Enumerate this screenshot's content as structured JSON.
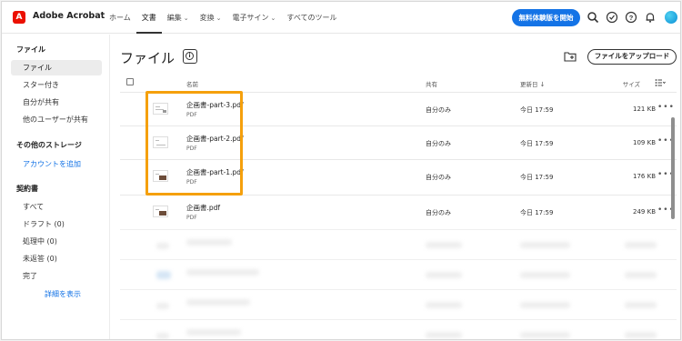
{
  "topbar": {
    "app_name": "Adobe Acrobat",
    "nav": [
      {
        "label": "ホーム",
        "dropdown": false,
        "active": false
      },
      {
        "label": "文書",
        "dropdown": false,
        "active": true
      },
      {
        "label": "編集",
        "dropdown": true,
        "active": false
      },
      {
        "label": "変換",
        "dropdown": true,
        "active": false
      },
      {
        "label": "電子サイン",
        "dropdown": true,
        "active": false
      },
      {
        "label": "すべてのツール",
        "dropdown": false,
        "active": false
      }
    ],
    "trial_button": "無料体験版を開始",
    "icons": [
      "search-icon",
      "check-circle-icon",
      "help-icon",
      "bell-icon",
      "avatar"
    ],
    "accent_color": "#1473e6"
  },
  "sidebar": {
    "files_heading": "ファイル",
    "files_items": [
      "ファイル",
      "スター付き",
      "自分が共有",
      "他のユーザーが共有"
    ],
    "storage_heading": "その他のストレージ",
    "add_account": "アカウントを追加",
    "agreements_heading": "契約書",
    "agreement_items": [
      "すべて",
      "ドラフト (0)",
      "処理中 (0)",
      "未返答 (0)",
      "完了"
    ],
    "show_details": "詳細を表示"
  },
  "main": {
    "title": "ファイル",
    "upload_button": "ファイルをアップロード",
    "columns": {
      "name": "名前",
      "shared": "共有",
      "modified": "更新日",
      "size": "サイズ"
    },
    "files": [
      {
        "name": "企画書-part-3.pdf",
        "type": "PDF",
        "shared": "自分のみ",
        "modified": "今日 17:59",
        "size": "121 KB"
      },
      {
        "name": "企画書-part-2.pdf",
        "type": "PDF",
        "shared": "自分のみ",
        "modified": "今日 17:59",
        "size": "109 KB"
      },
      {
        "name": "企画書-part-1.pdf",
        "type": "PDF",
        "shared": "自分のみ",
        "modified": "今日 17:59",
        "size": "176 KB"
      },
      {
        "name": "企画書.pdf",
        "type": "PDF",
        "shared": "自分のみ",
        "modified": "今日 17:59",
        "size": "249 KB"
      }
    ],
    "highlight_color": "#f5a00c"
  }
}
